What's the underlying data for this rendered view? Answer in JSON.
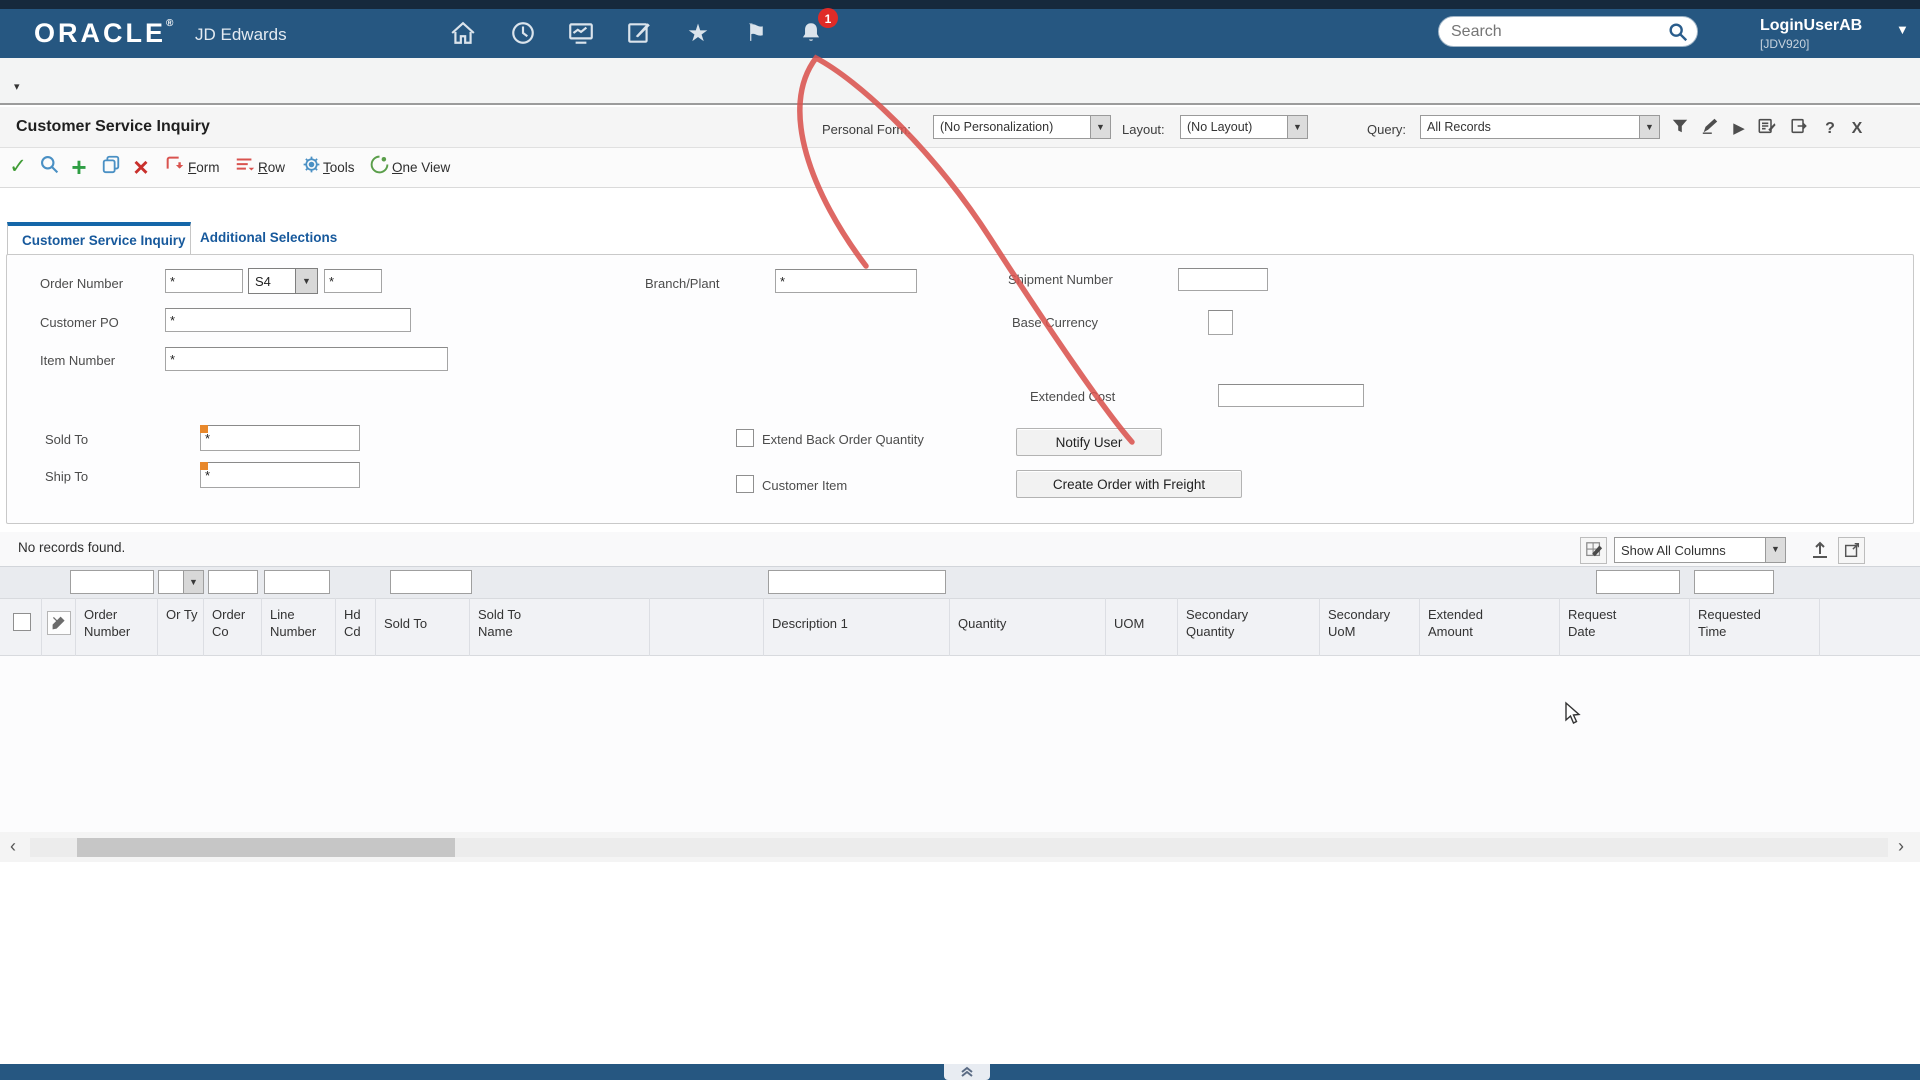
{
  "header": {
    "brand_oracle": "ORACLE",
    "brand_product": "JD Edwards",
    "notification_count": "1",
    "search_placeholder": "Search",
    "user_name": "LoginUserAB",
    "user_env": "[JDV920]"
  },
  "title_bar": {
    "title": "Customer Service Inquiry",
    "personal_form_label": "Personal Form:",
    "personal_form_value": "(No Personalization)",
    "layout_label": "Layout:",
    "layout_value": "(No Layout)",
    "query_label": "Query:",
    "query_value": "All Records",
    "help_label": "?",
    "close_label": "X"
  },
  "toolbar": {
    "form_label": "Form",
    "row_label": "Row",
    "tools_label": "Tools",
    "one_view_label": "One View"
  },
  "tabs": {
    "tab1": "Customer Service Inquiry",
    "tab2": "Additional Selections"
  },
  "form": {
    "order_number_label": "Order Number",
    "order_number_value": "*",
    "order_type_value": "S4",
    "order_number_to_value": "*",
    "customer_po_label": "Customer PO",
    "customer_po_value": "*",
    "item_number_label": "Item Number",
    "item_number_value": "*",
    "sold_to_label": "Sold To",
    "sold_to_value": "*",
    "ship_to_label": "Ship To",
    "ship_to_value": "*",
    "branch_plant_label": "Branch/Plant",
    "branch_plant_value": "*",
    "shipment_number_label": "Shipment Number",
    "shipment_number_value": "",
    "base_currency_label": "Base Currency",
    "extended_cost_label": "Extended Cost",
    "extended_cost_value": "",
    "extend_back_order_label": "Extend Back Order Quantity",
    "customer_item_label": "Customer Item",
    "notify_user_button": "Notify User",
    "create_order_button": "Create Order with Freight"
  },
  "grid": {
    "status_message": "No records found.",
    "show_columns_value": "Show All Columns",
    "columns": [
      "Order Number",
      "Or Ty",
      "Order Co",
      "Line Number",
      "Hd Cd",
      "Sold To",
      "Sold To Name",
      "Description 1",
      "Quantity",
      "UOM",
      "Secondary Quantity",
      "Secondary UoM",
      "Extended Amount",
      "Request Date",
      "Requested Time"
    ]
  },
  "icons": {
    "dropdown": "▼",
    "check": "✓",
    "plus": "+",
    "close_x": "×",
    "star": "★",
    "flag": "⚑",
    "play": "▶",
    "scroll_left": "‹",
    "scroll_right": "›",
    "panel_collapse": "▾"
  },
  "colors": {
    "header_navy": "#265781",
    "accent_blue": "#17599c",
    "annotation_red": "#d9534f",
    "badge_red": "#e02b27"
  }
}
